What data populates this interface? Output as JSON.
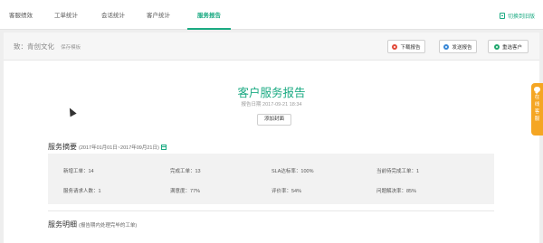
{
  "nav": {
    "tabs": [
      {
        "label": "客服绩效"
      },
      {
        "label": "工单统计"
      },
      {
        "label": "会话统计"
      },
      {
        "label": "客户统计"
      },
      {
        "label": "服务报告"
      }
    ],
    "active_tab": "服务报告",
    "switch_old_label": "切换到旧版"
  },
  "header": {
    "to_label": "致：青创文化",
    "save_template_label": "保存模板",
    "buttons": {
      "download": "下载报告",
      "send": "发送报告",
      "choose_customer": "重选客户"
    }
  },
  "report": {
    "title": "客户服务报告",
    "date": "报告日期 2017-09-21 18:34",
    "add_cover_label": "添加封面"
  },
  "summary": {
    "title": "服务摘要",
    "range": "(2017年01月01日~2017年09月21日)",
    "rows": [
      [
        "新增工单：14",
        "完成工单：13",
        "SLA达标率：100%",
        "当前待完成工单：1"
      ],
      [
        "服务请求人数：1",
        "满意度：77%",
        "评价率：54%",
        "问题解决率：85%"
      ]
    ]
  },
  "detail": {
    "title": "服务明细",
    "subtitle": "(报告期内处理完毕的工单)"
  },
  "float_service": {
    "label_chars": [
      "在",
      "线",
      "客",
      "服"
    ]
  },
  "colors": {
    "accent": "#1aaa82",
    "float": "#f5a623"
  }
}
